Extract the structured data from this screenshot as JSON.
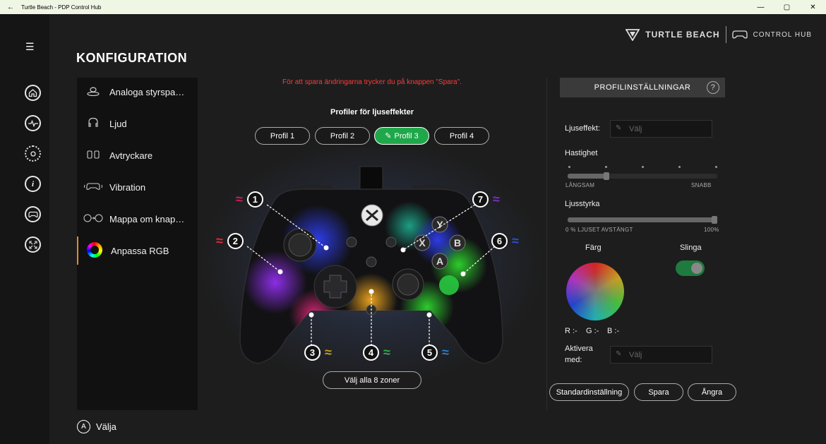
{
  "window": {
    "title": "Turtle Beach - PDP Control Hub",
    "back_icon": "←",
    "min_icon": "—",
    "max_icon": "▢",
    "close_icon": "✕"
  },
  "rail": {
    "menu_icon": "☰",
    "icons": [
      "home-icon",
      "activity-icon",
      "settings-icon",
      "info-icon",
      "controller-icon",
      "fullscreen-icon"
    ]
  },
  "brand": {
    "name": "TURTLE BEACH",
    "product": "CONTROL HUB"
  },
  "page": {
    "title": "KONFIGURATION"
  },
  "nav": {
    "items": [
      {
        "label": "Analoga styrspa…",
        "icon": "joystick-icon"
      },
      {
        "label": "Ljud",
        "icon": "headset-icon"
      },
      {
        "label": "Avtryckare",
        "icon": "trigger-icon"
      },
      {
        "label": "Vibration",
        "icon": "vibration-icon"
      },
      {
        "label": "Mappa om knap…",
        "icon": "remap-icon"
      },
      {
        "label": "Anpassa RGB",
        "icon": "rgb-icon"
      }
    ],
    "active_index": 5
  },
  "footer": {
    "a_glyph": "A",
    "select_label": "Välja"
  },
  "main": {
    "notice": "För att spara ändringarna trycker du på knappen \"Spara\".",
    "profiles_heading": "Profiler för ljuseffekter",
    "profiles": [
      "Profil 1",
      "Profil 2",
      "Profil 3",
      "Profil 4"
    ],
    "selected_profile_index": 2,
    "edit_icon": "✎",
    "zones": [
      {
        "n": "1",
        "color": "#d0205a"
      },
      {
        "n": "2",
        "color": "#e82a2a"
      },
      {
        "n": "3",
        "color": "#c9a020"
      },
      {
        "n": "4",
        "color": "#2fb04a"
      },
      {
        "n": "5",
        "color": "#2a7fd0"
      },
      {
        "n": "6",
        "color": "#2a50d8"
      },
      {
        "n": "7",
        "color": "#7a30c8"
      }
    ],
    "select_all_label": "Välj alla 8 zoner"
  },
  "panel": {
    "heading": "PROFILINSTÄLLNINGAR",
    "help": "?",
    "effect_label": "Ljuseffekt:",
    "effect_placeholder": "Välj",
    "speed_label": "Hastighet",
    "speed_min": "LÅNGSAM",
    "speed_max": "SNABB",
    "speed_value": 0.25,
    "brightness_label": "Ljusstyrka",
    "brightness_min": "0 % LJUSET AVSTÄNGT",
    "brightness_max": "100%",
    "brightness_value": 1.0,
    "color_label": "Färg",
    "loop_label": "Slinga",
    "loop_on": true,
    "rgb_r": "R :-",
    "rgb_g": "G :-",
    "rgb_b": "B :-",
    "activate_label_1": "Aktivera",
    "activate_label_2": "med:",
    "activate_placeholder": "Välj",
    "buttons": {
      "default": "Standardinställning",
      "save": "Spara",
      "undo": "Ångra"
    }
  }
}
